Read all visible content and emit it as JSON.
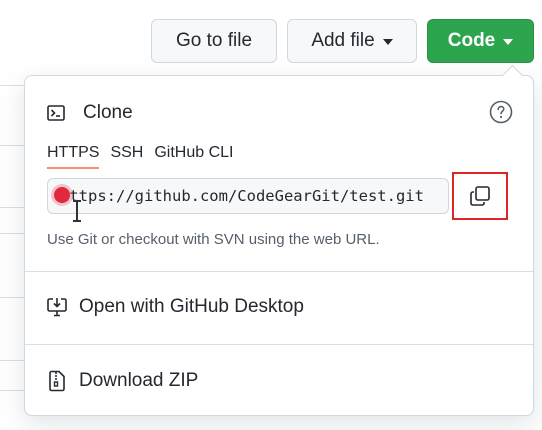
{
  "toolbar": {
    "go_to_file": "Go to file",
    "add_file": "Add file",
    "code": "Code"
  },
  "clone": {
    "title": "Clone",
    "tabs": [
      "HTTPS",
      "SSH",
      "GitHub CLI"
    ],
    "active_tab": "HTTPS",
    "url": "https://github.com/CodeGearGit/test.git",
    "hint": "Use Git or checkout with SVN using the web URL."
  },
  "menu": {
    "open_desktop": "Open with GitHub Desktop",
    "download_zip": "Download ZIP"
  },
  "colors": {
    "code_button": "#2da44e",
    "active_tab_underline": "#fd8c73",
    "highlight_box": "#e02323"
  },
  "icons": [
    "terminal-icon",
    "question-icon",
    "copy-icon",
    "desktop-download-icon",
    "file-zip-icon"
  ]
}
